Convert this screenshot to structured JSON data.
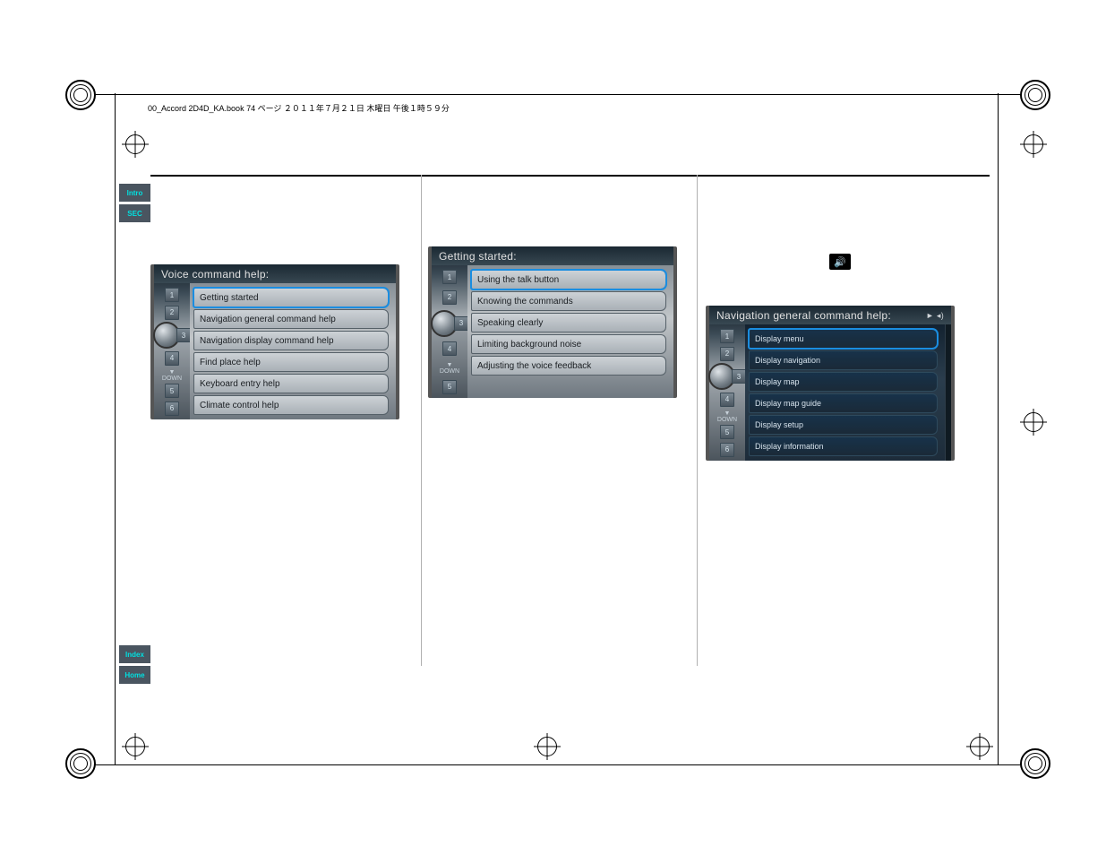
{
  "runheader": "00_Accord 2D4D_KA.book  74 ページ  ２０１１年７月２１日  木曜日  午後１時５９分",
  "side_tabs": {
    "intro": "Intro",
    "sec": "SEC",
    "index": "Index",
    "home": "Home"
  },
  "panels": {
    "voice_help": {
      "title": "Voice command help:",
      "items": [
        "Getting started",
        "Navigation general command help",
        "Navigation display command help",
        "Find place help",
        "Keyboard entry help",
        "Climate control help"
      ],
      "selected": 0
    },
    "getting_started": {
      "title": "Getting started:",
      "items": [
        "Using the talk button",
        "Knowing the commands",
        "Speaking clearly",
        "Limiting background noise",
        "Adjusting the voice feedback"
      ],
      "selected": 0
    },
    "nav_general": {
      "title": "Navigation general command help:",
      "items": [
        "Display menu",
        "Display navigation",
        "Display map",
        "Display map guide",
        "Display setup",
        "Display information"
      ],
      "selected": 0
    }
  },
  "knob": {
    "down": "▼",
    "down_label": "DOWN"
  },
  "icons": {
    "speaker": "🔊",
    "play": "►",
    "sound": "◂)"
  }
}
